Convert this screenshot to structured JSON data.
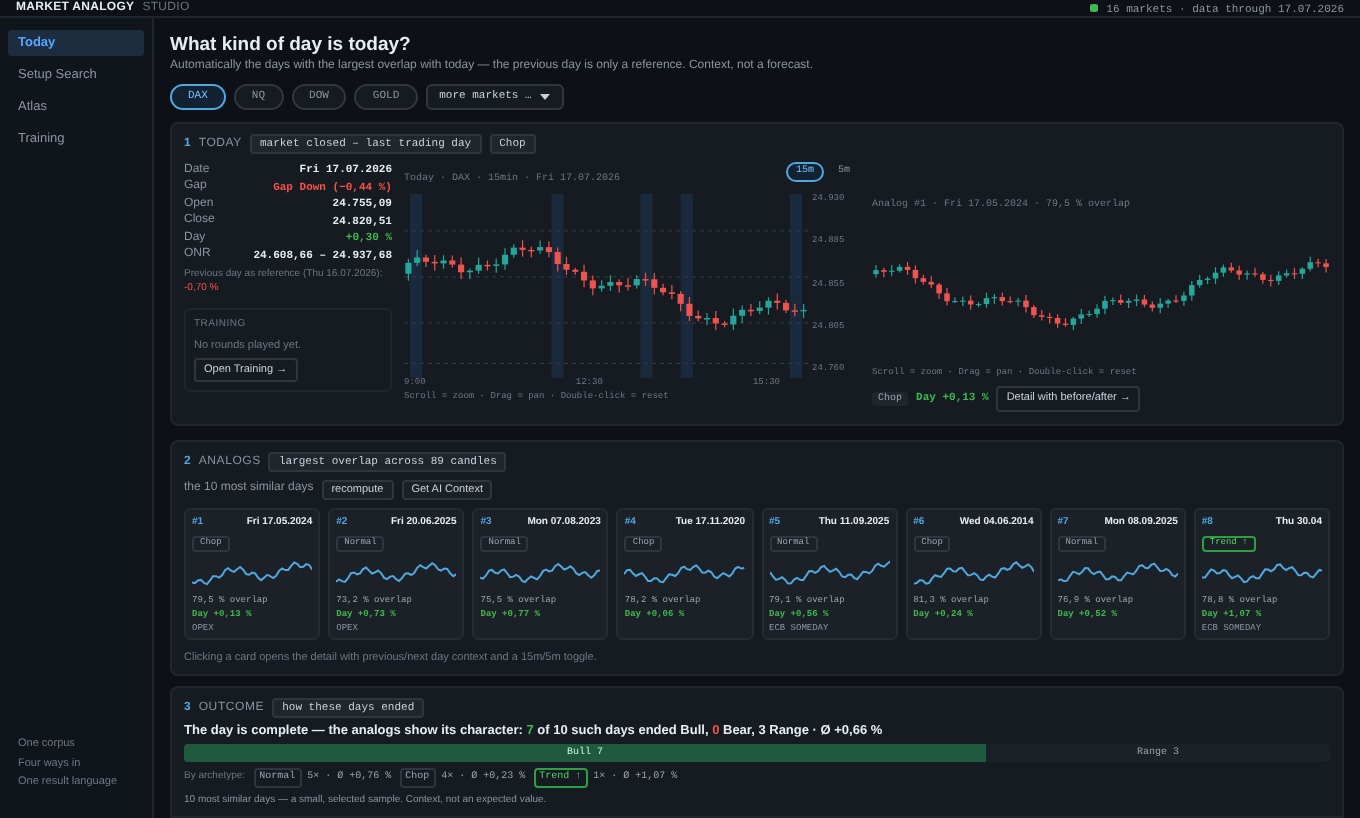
{
  "header": {
    "brand": "MARKET ANALOGY",
    "brand_suffix": "STUDIO",
    "status": "16 markets · data through 17.07.2026"
  },
  "sidebar": {
    "items": [
      {
        "label": "Today",
        "selected": true
      },
      {
        "label": "Setup Search",
        "selected": false
      },
      {
        "label": "Atlas",
        "selected": false
      },
      {
        "label": "Training",
        "selected": false
      }
    ],
    "footer": [
      "One corpus",
      "Four ways in",
      "One result language"
    ]
  },
  "page": {
    "title": "What kind of day is today?",
    "subtitle": "Automatically the days with the largest overlap with today — the previous day is only a reference. Context, not a forecast."
  },
  "markets": [
    {
      "label": "DAX",
      "selected": true
    },
    {
      "label": "NQ",
      "selected": false
    },
    {
      "label": "DOW",
      "selected": false
    },
    {
      "label": "GOLD",
      "selected": false
    }
  ],
  "more_markets": "more markets …",
  "today": {
    "number": "1",
    "label": "TODAY",
    "badges": [
      "market closed – last trading day",
      "Chop"
    ],
    "stats": [
      {
        "label": "Date",
        "value": "Fri 17.07.2026",
        "kind": "plain"
      },
      {
        "label": "Gap",
        "value": "Gap Down (−0,44 %)",
        "kind": "down"
      },
      {
        "label": "Open",
        "value": "24.755,09",
        "kind": "plain"
      },
      {
        "label": "Close",
        "value": "24.820,51",
        "kind": "plain"
      },
      {
        "label": "Day",
        "value": "+0,30 %",
        "kind": "up"
      },
      {
        "label": "ONR",
        "value": "24.608,66 – 24.937,68",
        "kind": "plain"
      }
    ],
    "previous_day": {
      "text": "Previous day as reference (Thu 16.07.2026):",
      "value": "-0,70 %"
    },
    "training": {
      "title": "TRAINING",
      "text": "No rounds played yet.",
      "button": "Open Training →"
    },
    "chart": {
      "caption": "Today · DAX · 15min · Fri 17.07.2026",
      "intervals": [
        {
          "label": "15m",
          "selected": true
        },
        {
          "label": "5m",
          "selected": false
        }
      ],
      "yticks": [
        "24.930",
        "24.885",
        "24.855",
        "24.805",
        "24.760"
      ],
      "xticks": [
        "9:00",
        "12:30",
        "15:30"
      ],
      "hint": "Scroll = zoom · Drag = pan · Double-click = reset"
    },
    "analog_chart": {
      "caption": "Analog #1 · Fri 17.05.2024 · 79,5 % overlap",
      "hint": "Scroll = zoom · Drag = pan · Double-click = reset",
      "regime": "Chop",
      "day": "Day +0,13 %",
      "button": "Detail with before/after →"
    }
  },
  "analogs": {
    "number": "2",
    "label": "ANALOGS",
    "badge": "largest overlap across 89 candles",
    "intro": "the 10 most similar days",
    "buttons": [
      "recompute",
      "Get AI Context"
    ],
    "cards": [
      {
        "rank": "#1",
        "date": "Fri 17.05.2024",
        "regime": "Chop",
        "kind": "neutral",
        "overlap": "79,5 % overlap",
        "day": "Day +0,13 %",
        "note": "OPEX"
      },
      {
        "rank": "#2",
        "date": "Fri 20.06.2025",
        "regime": "Normal",
        "kind": "neutral",
        "overlap": "73,2 % overlap",
        "day": "Day +0,73 %",
        "note": "OPEX"
      },
      {
        "rank": "#3",
        "date": "Mon 07.08.2023",
        "regime": "Normal",
        "kind": "neutral",
        "overlap": "75,5 % overlap",
        "day": "Day +0,77 %"
      },
      {
        "rank": "#4",
        "date": "Tue 17.11.2020",
        "regime": "Chop",
        "kind": "neutral",
        "overlap": "78,2 % overlap",
        "day": "Day +0,06 %"
      },
      {
        "rank": "#5",
        "date": "Thu 11.09.2025",
        "regime": "Normal",
        "kind": "neutral",
        "overlap": "79,1 % overlap",
        "day": "Day +0,56 %",
        "note": "ECB SOMEDAY"
      },
      {
        "rank": "#6",
        "date": "Wed 04.06.2014",
        "regime": "Chop",
        "kind": "neutral",
        "overlap": "81,3 % overlap",
        "day": "Day +0,24 %"
      },
      {
        "rank": "#7",
        "date": "Mon 08.09.2025",
        "regime": "Normal",
        "kind": "neutral",
        "overlap": "76,9 % overlap",
        "day": "Day +0,52 %"
      },
      {
        "rank": "#8",
        "date": "Thu 30.04",
        "regime": "Trend ↑",
        "kind": "trend",
        "overlap": "78,8 % overlap",
        "day": "Day +1,07 %",
        "note": "ECB SOMEDAY"
      }
    ],
    "footnote": "Clicking a card opens the detail with previous/next day context and a 15m/5m toggle."
  },
  "outcome": {
    "number": "3",
    "label": "OUTCOME",
    "badge": "how these days ended",
    "sentence": [
      {
        "text": "The day is complete — the analogs show its character: ",
        "kind": "plain"
      },
      {
        "text": "7",
        "kind": "bull"
      },
      {
        "text": " of 10 such days ended Bull, ",
        "kind": "plain"
      },
      {
        "text": "0",
        "kind": "bear"
      },
      {
        "text": " Bear, 3 Range · Ø +0,66 %",
        "kind": "plain"
      }
    ],
    "segments": [
      {
        "label": "Bull 7",
        "kind": "bull",
        "level": 0.7
      },
      {
        "label": "Range 3",
        "kind": "range",
        "level": 0.3
      }
    ],
    "archetype_label": "By archetype:",
    "archetypes": [
      {
        "label": "Normal",
        "kind": "neutral",
        "text": "5× · Ø +0,76 %"
      },
      {
        "label": "Chop",
        "kind": "neutral",
        "text": "4× · Ø +0,23 %"
      },
      {
        "label": "Trend ↑",
        "kind": "trend",
        "text": "1× · Ø +1,07 %"
      }
    ],
    "footnote": "10 most similar days — a small, selected sample. Context, not an expected value."
  }
}
